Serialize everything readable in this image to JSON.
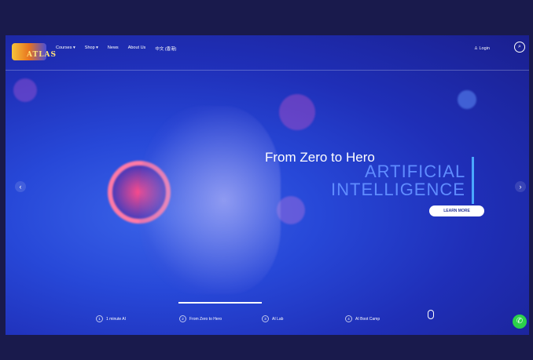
{
  "nav": {
    "logo_text": "ATLAS",
    "menu": [
      "Courses ▾",
      "Shop ▾",
      "News",
      "About Us",
      "中文 (香港)"
    ],
    "login": "♙ Login",
    "search_icon": "⌕"
  },
  "hero": {
    "line1": "From Zero to Hero",
    "line2": "ARTIFICIAL",
    "line3": "INTELLIGENCE",
    "cta": "LEARN MORE"
  },
  "slides": [
    {
      "num": "1",
      "label": "1 minute AI"
    },
    {
      "num": "2",
      "label": "From Zero to Hero"
    },
    {
      "num": "3",
      "label": "AI Lab"
    },
    {
      "num": "4",
      "label": "AI Boot Camp"
    }
  ],
  "icons": {
    "prev": "‹",
    "next": "›",
    "whatsapp": "✆"
  },
  "colors": {
    "accent": "#5f8cff",
    "bg": "#2748d8",
    "whatsapp": "#2bd24a"
  }
}
